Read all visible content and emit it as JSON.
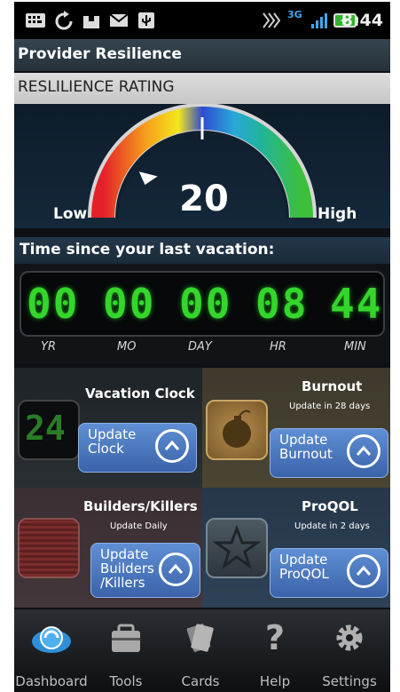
{
  "status_bar": {
    "time": "8:44",
    "network": "3G"
  },
  "app_title": "Provider Resilience",
  "rating": {
    "header": "RESLILIENCE RATING",
    "value": "20",
    "level": 0.2,
    "low_label": "Low",
    "high_label": "High"
  },
  "vacation": {
    "header": "Time since your last vacation:",
    "digits": [
      "00",
      "00",
      "00",
      "08",
      "44"
    ],
    "units": [
      "YR",
      "MO",
      "DAY",
      "HR",
      "MIN"
    ]
  },
  "tiles": [
    {
      "title": "Vacation Clock",
      "subtitle": "",
      "icon_text": "24",
      "button": "Update\nClock"
    },
    {
      "title": "Burnout",
      "subtitle": "Update in 28 days",
      "button": "Update\nBurnout"
    },
    {
      "title": "Builders/Killers",
      "subtitle": "Update Daily",
      "button": "Update\nBuilders\n/Killers"
    },
    {
      "title": "ProQOL",
      "subtitle": "Update in 2 days",
      "button": "Update\nProQOL"
    }
  ],
  "nav": [
    "Dashboard",
    "Tools",
    "Cards",
    "Help",
    "Settings"
  ],
  "colors": {
    "accent_button": "#4a78c0",
    "lcd_green": "#34d62b"
  }
}
